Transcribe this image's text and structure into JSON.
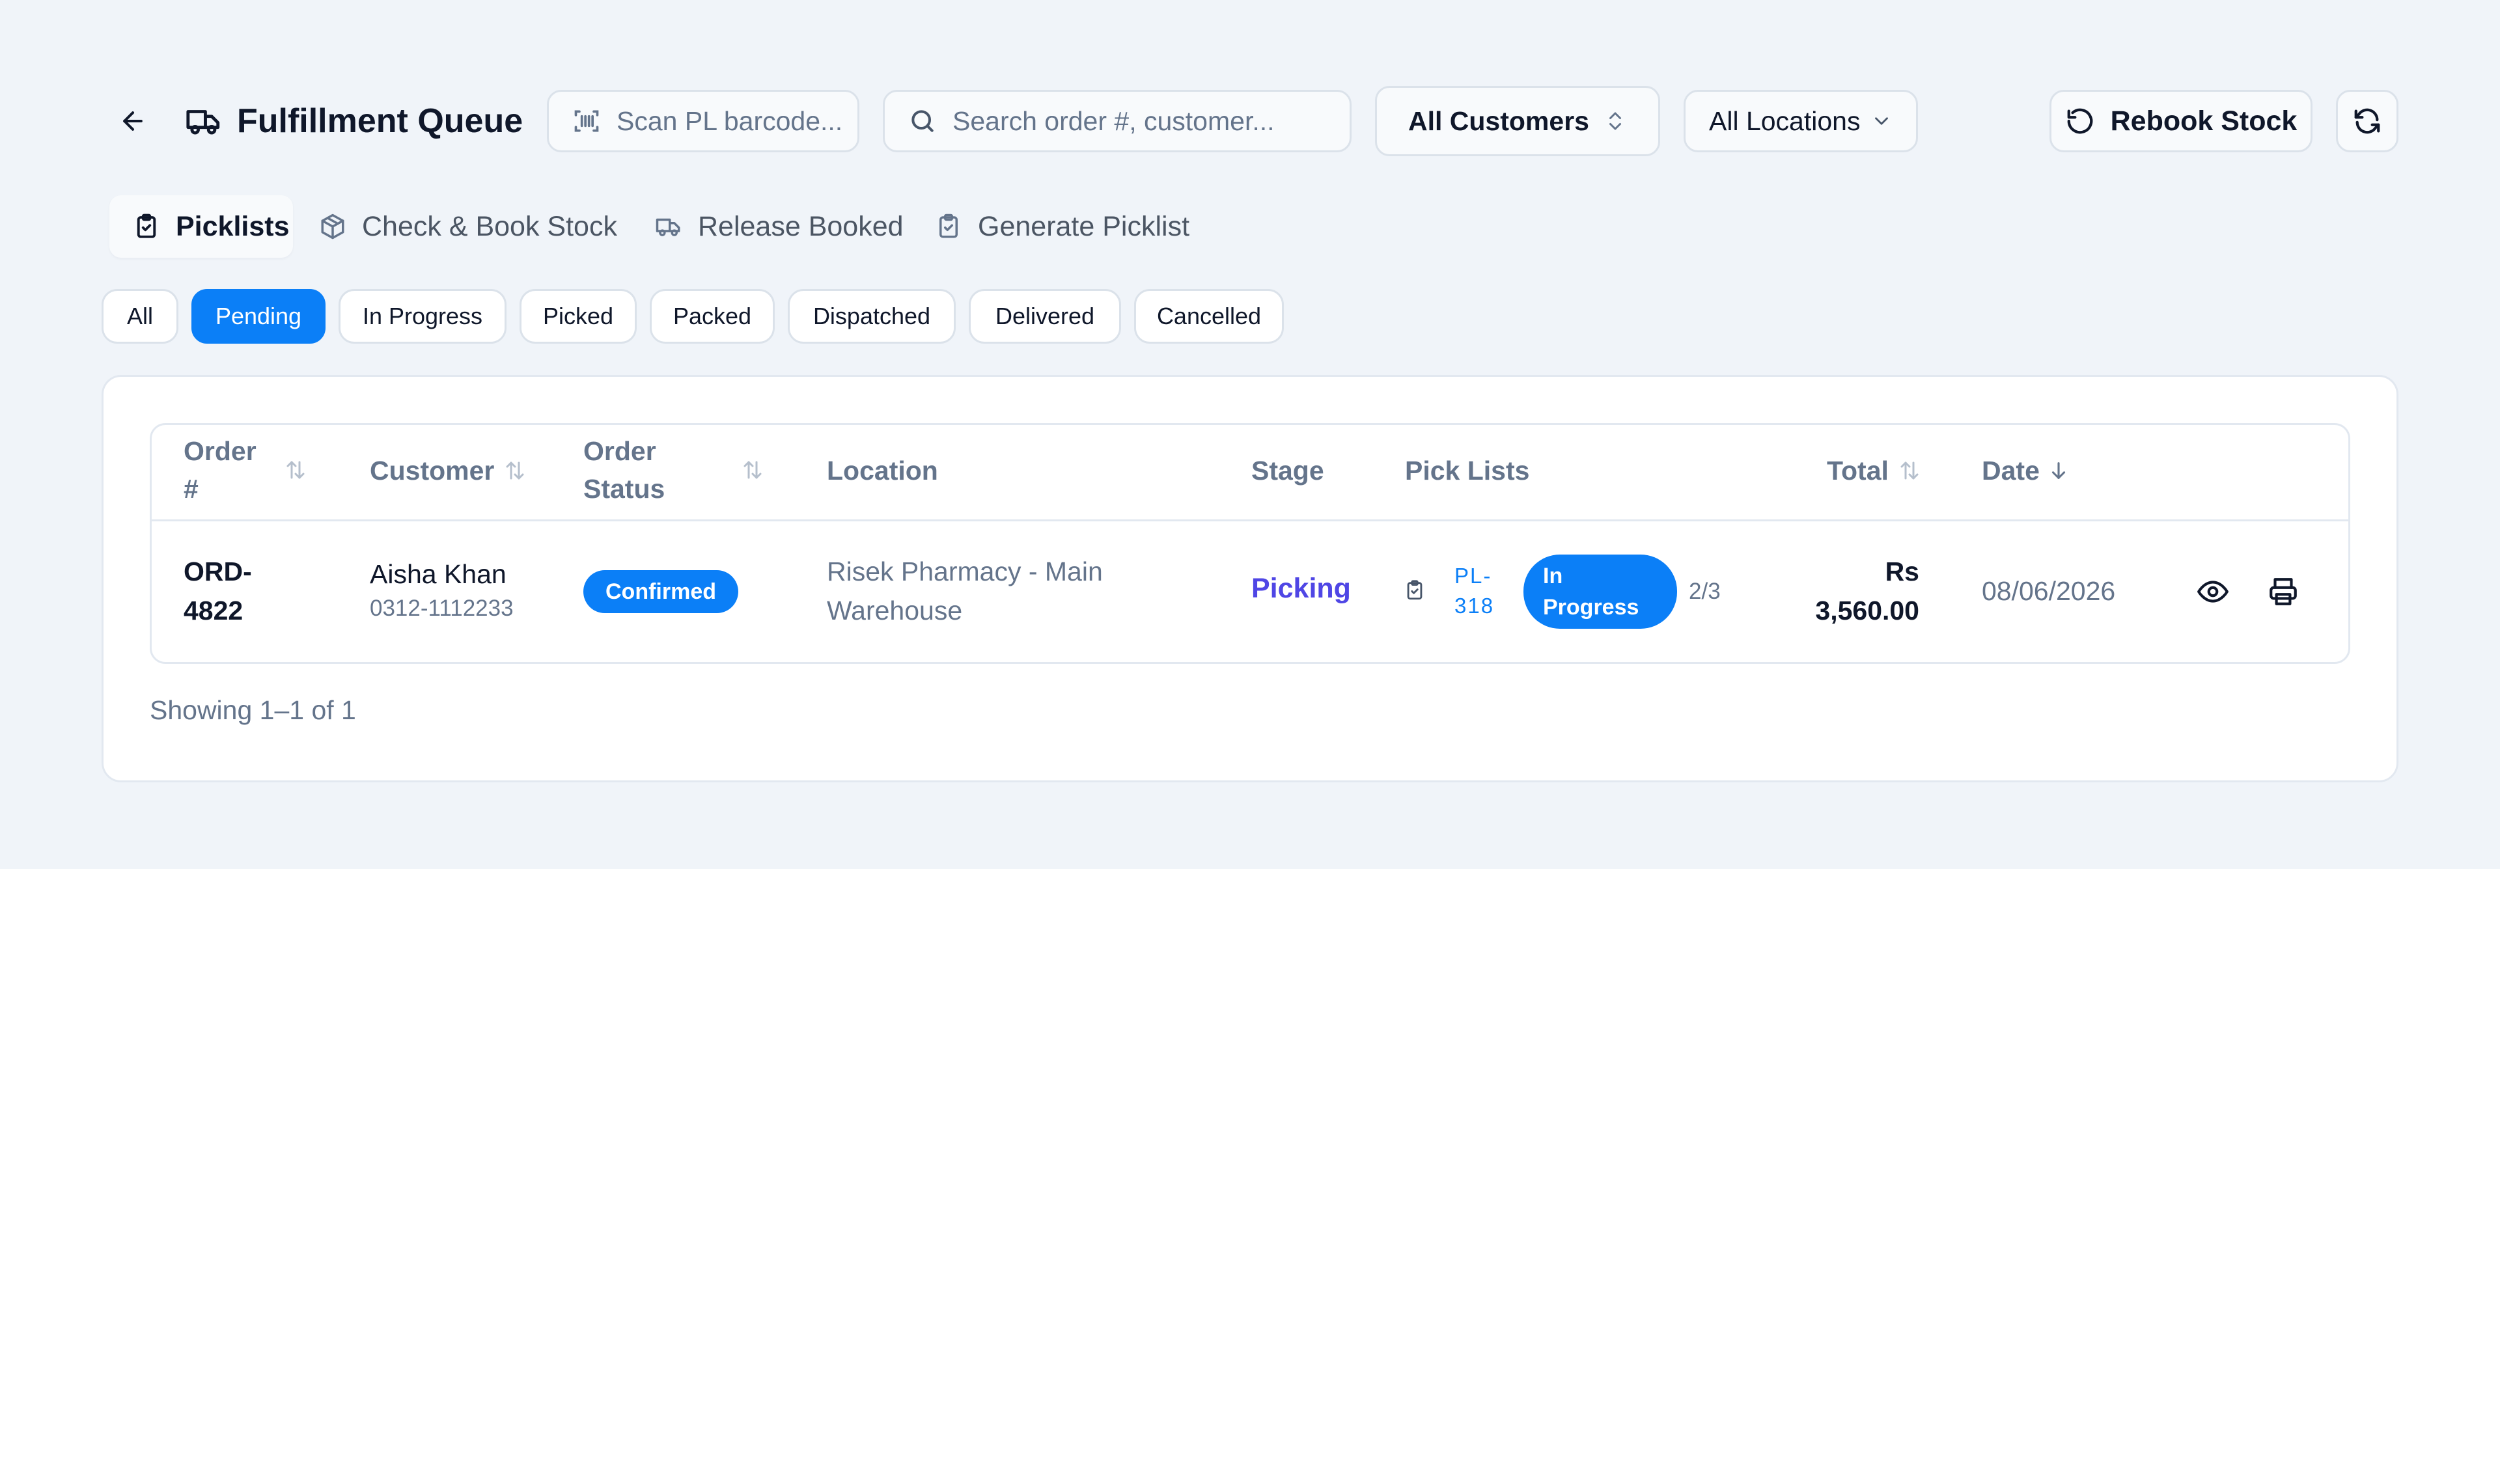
{
  "header": {
    "title": "Fulfillment Queue",
    "scan_placeholder": "Scan PL barcode...",
    "search_placeholder": "Search order #, customer...",
    "customer_filter": "All Customers",
    "location_filter": "All Locations",
    "rebook_label": "Rebook Stock"
  },
  "tabs": [
    {
      "label": "Picklists",
      "icon": "clipboard-check-icon",
      "active": true
    },
    {
      "label": "Check & Book Stock",
      "icon": "package-icon",
      "active": false
    },
    {
      "label": "Release Booked",
      "icon": "truck-icon",
      "active": false
    },
    {
      "label": "Generate Picklist",
      "icon": "clipboard-check-icon",
      "active": false
    }
  ],
  "status_filters": [
    {
      "label": "All",
      "active": false
    },
    {
      "label": "Pending",
      "active": true
    },
    {
      "label": "In Progress",
      "active": false
    },
    {
      "label": "Picked",
      "active": false
    },
    {
      "label": "Packed",
      "active": false
    },
    {
      "label": "Dispatched",
      "active": false
    },
    {
      "label": "Delivered",
      "active": false
    },
    {
      "label": "Cancelled",
      "active": false
    }
  ],
  "table": {
    "columns": {
      "order_line1": "Order",
      "order_line2": "#",
      "customer": "Customer",
      "status_line1": "Order",
      "status_line2": "Status",
      "location": "Location",
      "stage": "Stage",
      "pick_lists": "Pick Lists",
      "total": "Total",
      "date": "Date"
    },
    "rows": [
      {
        "order_line1": "ORD-",
        "order_line2": "4822",
        "customer_name": "Aisha Khan",
        "customer_phone": "0312-1112233",
        "order_status": "Confirmed",
        "location_line1": "Risek Pharmacy - Main",
        "location_line2": "Warehouse",
        "stage": "Picking",
        "picklist_line1": "PL-",
        "picklist_line2": "318",
        "picklist_status_line1": "In",
        "picklist_status_line2": "Progress",
        "picklist_progress": "2/3",
        "total_line1": "Rs",
        "total_line2": "3,560.00",
        "date": "08/06/2026"
      }
    ]
  },
  "pagination": {
    "summary": "Showing 1–1 of 1"
  },
  "colors": {
    "accent": "#0b7ff7",
    "stage": "#4f46e5",
    "background": "#f0f4f9",
    "border": "#dbe2ea",
    "muted_text": "#64748b"
  }
}
